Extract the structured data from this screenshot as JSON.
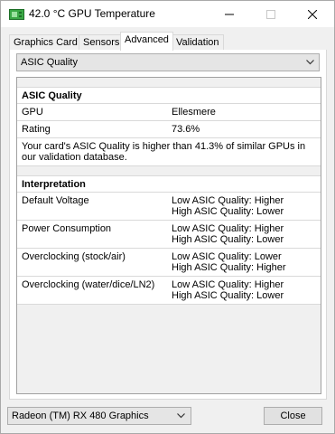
{
  "window": {
    "title": "42.0 °C GPU Temperature",
    "app_icon": "gpu-card-icon",
    "controls": [
      "minimize-icon",
      "maximize-icon",
      "close-icon"
    ]
  },
  "tabs": [
    {
      "label": "Graphics Card",
      "active": false
    },
    {
      "label": "Sensors",
      "active": false
    },
    {
      "label": "Advanced",
      "active": true
    },
    {
      "label": "Validation",
      "active": false
    }
  ],
  "toolbar_icons": [
    "camera-icon",
    "refresh-icon",
    "menu-icon"
  ],
  "category_select": {
    "value": "ASIC Quality"
  },
  "asic_section": {
    "title": "ASIC Quality",
    "rows": [
      {
        "key": "GPU",
        "value": "Ellesmere"
      },
      {
        "key": "Rating",
        "value": "73.6%"
      }
    ],
    "note": "Your card's ASIC Quality is higher than 41.3% of similar GPUs in our validation database."
  },
  "interpretation_section": {
    "title": "Interpretation",
    "rows": [
      {
        "key": "Default Voltage",
        "value": "Low ASIC Quality: Higher\nHigh ASIC Quality: Lower"
      },
      {
        "key": "Power Consumption",
        "value": "Low ASIC Quality: Higher\nHigh ASIC Quality: Lower"
      },
      {
        "key": "Overclocking (stock/air)",
        "value": "Low ASIC Quality: Lower\nHigh ASIC Quality: Higher"
      },
      {
        "key": "Overclocking (water/dice/LN2)",
        "value": "Low ASIC Quality: Higher\nHigh ASIC Quality: Lower"
      }
    ]
  },
  "footer": {
    "gpu_select": "Radeon (TM) RX 480 Graphics",
    "close_label": "Close"
  },
  "colors": {
    "icon_green": "#3aa845",
    "border": "#adadad",
    "panel": "#f0f0f0"
  }
}
